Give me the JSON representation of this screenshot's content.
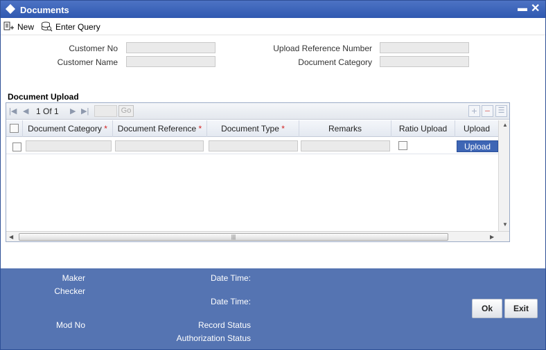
{
  "window": {
    "title": "Documents",
    "minimize": "▬",
    "close": "✕"
  },
  "toolbar": {
    "new_label": "New",
    "enter_query_label": "Enter Query"
  },
  "form": {
    "customer_no_label": "Customer No",
    "customer_no_value": "",
    "customer_name_label": "Customer Name",
    "customer_name_value": "",
    "upload_ref_label": "Upload Reference Number",
    "upload_ref_value": "",
    "document_category_label": "Document Category",
    "document_category_value": ""
  },
  "document_upload": {
    "section_title": "Document Upload",
    "pagination": {
      "current": "1",
      "of_label": "Of",
      "total": "1",
      "go_label": "Go"
    },
    "columns": [
      {
        "label": "Document Category",
        "required": "*"
      },
      {
        "label": "Document Reference",
        "required": "*"
      },
      {
        "label": "Document Type",
        "required": "*"
      },
      {
        "label": "Remarks",
        "required": ""
      },
      {
        "label": "Ratio Upload",
        "required": ""
      },
      {
        "label": "Upload",
        "required": ""
      }
    ],
    "rows": [
      {
        "document_category": "",
        "document_reference": "",
        "document_type": "",
        "remarks": "",
        "ratio_upload": false,
        "upload_label": "Upload"
      }
    ]
  },
  "footer": {
    "maker_label": "Maker",
    "checker_label": "Checker",
    "date_time_label_1": "Date Time:",
    "date_time_label_2": "Date Time:",
    "mod_no_label": "Mod No",
    "record_status_label": "Record Status",
    "authorization_status_label": "Authorization Status",
    "ok_label": "Ok",
    "exit_label": "Exit"
  },
  "colors": {
    "title_bar": "#3a62b8",
    "footer": "#5574b2",
    "required": "#d21e1e",
    "upload_button": "#3e66b5"
  }
}
